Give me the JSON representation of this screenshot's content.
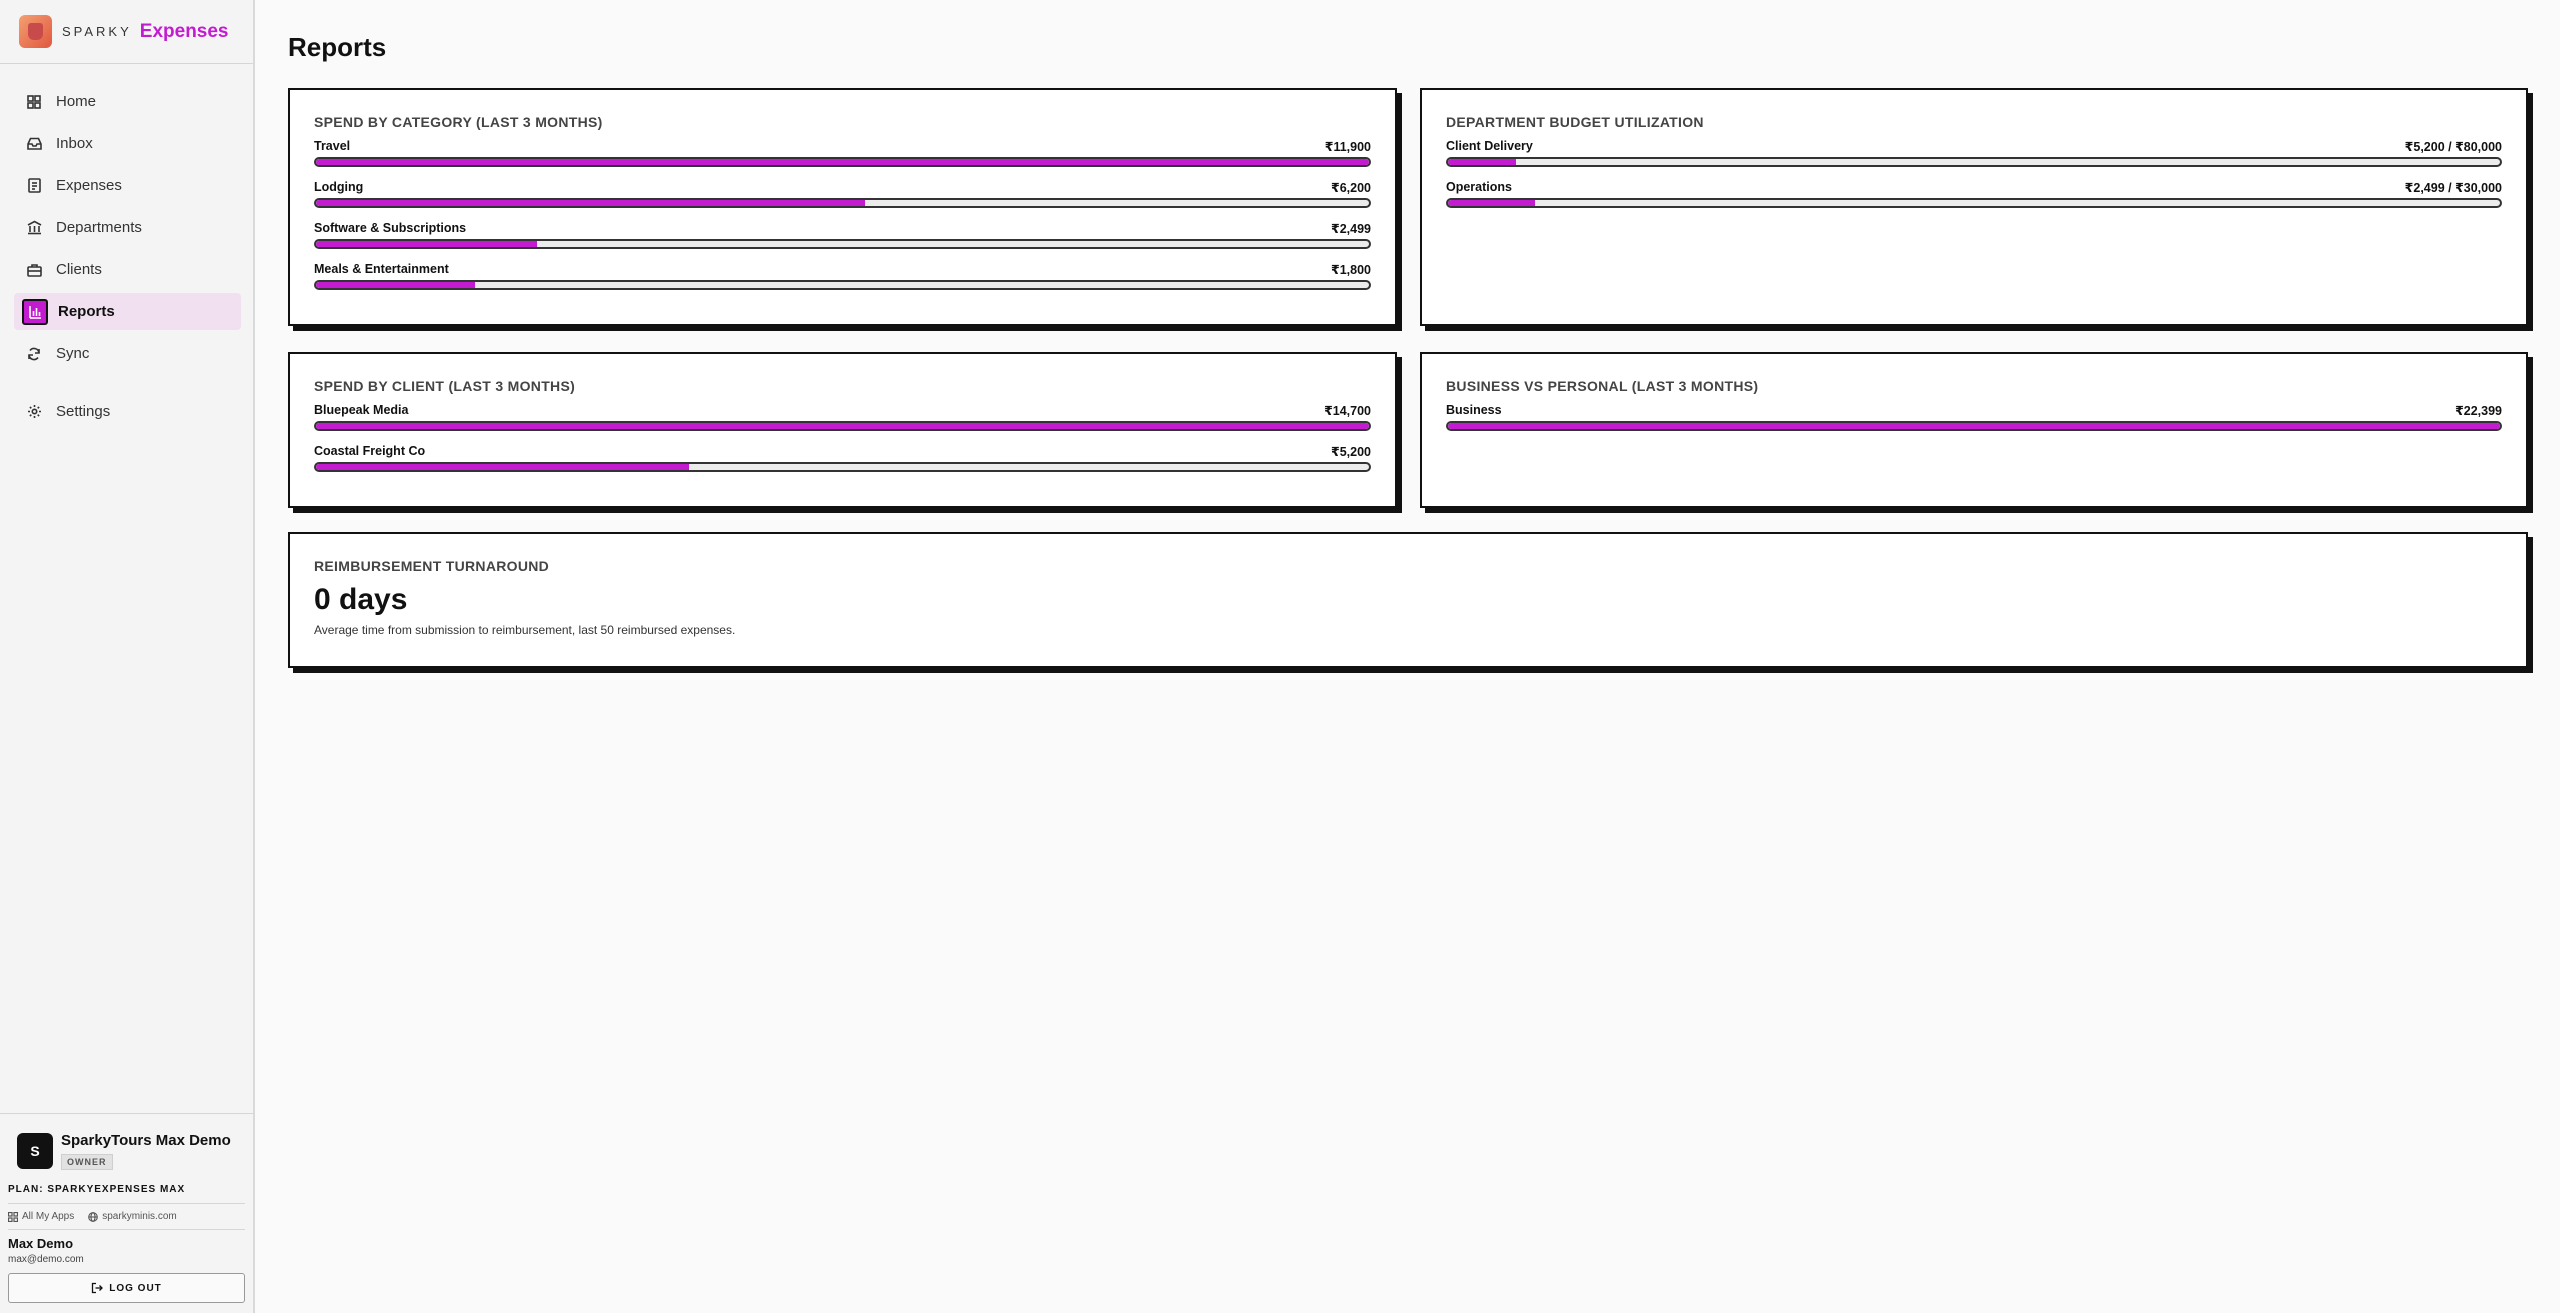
{
  "brand": {
    "sparky": "SPARKY",
    "product": "Expenses"
  },
  "nav": [
    {
      "label": "Home",
      "icon": "home-grid-icon"
    },
    {
      "label": "Inbox",
      "icon": "inbox-icon"
    },
    {
      "label": "Expenses",
      "icon": "receipt-icon"
    },
    {
      "label": "Departments",
      "icon": "building-icon"
    },
    {
      "label": "Clients",
      "icon": "clients-icon"
    },
    {
      "label": "Reports",
      "icon": "bar-chart-icon",
      "active": true
    },
    {
      "label": "Sync",
      "icon": "sync-icon"
    }
  ],
  "settings_label": "Settings",
  "org": {
    "avatar": "S",
    "name": "SparkyTours Max Demo",
    "role": "OWNER"
  },
  "plan": "PLAN: SPARKYEXPENSES MAX",
  "links": {
    "apps": "All My Apps",
    "site": "sparkyminis.com"
  },
  "user": {
    "name": "Max Demo",
    "email": "max@demo.com"
  },
  "logout": "LOG OUT",
  "page": {
    "title": "Reports"
  },
  "accent": "#c21bd0",
  "category": {
    "title": "SPEND BY CATEGORY (LAST 3 MONTHS)",
    "rows": [
      {
        "label": "Travel",
        "value": "₹11,900",
        "fraction": 1.0
      },
      {
        "label": "Lodging",
        "value": "₹6,200",
        "fraction": 0.521
      },
      {
        "label": "Software & Subscriptions",
        "value": "₹2,499",
        "fraction": 0.21
      },
      {
        "label": "Meals & Entertainment",
        "value": "₹1,800",
        "fraction": 0.151
      }
    ]
  },
  "department": {
    "title": "DEPARTMENT BUDGET UTILIZATION",
    "rows": [
      {
        "label": "Client Delivery",
        "value": "₹5,200 / ₹80,000",
        "fraction": 0.065
      },
      {
        "label": "Operations",
        "value": "₹2,499 / ₹30,000",
        "fraction": 0.083
      }
    ]
  },
  "client": {
    "title": "SPEND BY CLIENT (LAST 3 MONTHS)",
    "rows": [
      {
        "label": "Bluepeak Media",
        "value": "₹14,700",
        "fraction": 1.0
      },
      {
        "label": "Coastal Freight Co",
        "value": "₹5,200",
        "fraction": 0.354
      }
    ]
  },
  "business": {
    "title": "BUSINESS VS PERSONAL (LAST 3 MONTHS)",
    "rows": [
      {
        "label": "Business",
        "value": "₹22,399",
        "fraction": 1.0
      }
    ]
  },
  "turnaround": {
    "title": "REIMBURSEMENT TURNAROUND",
    "value": "0 days",
    "description": "Average time from submission to reimbursement, last 50 reimbursed expenses."
  }
}
